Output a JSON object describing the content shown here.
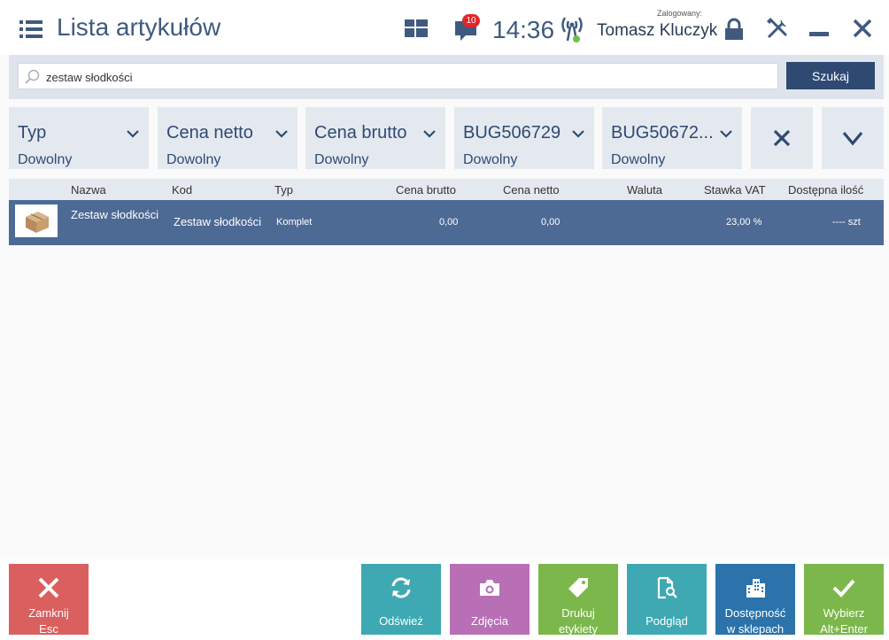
{
  "header": {
    "title": "Lista artykułów",
    "notification_count": "10",
    "time": "14:36",
    "logged_label": "Zalogowany:",
    "user_name": "Tomasz Kluczyk"
  },
  "search": {
    "value": "zestaw słodkości",
    "button_label": "Szukaj"
  },
  "filters": [
    {
      "label": "Typ",
      "value": "Dowolny"
    },
    {
      "label": "Cena netto",
      "value": "Dowolny"
    },
    {
      "label": "Cena brutto",
      "value": "Dowolny"
    },
    {
      "label": "BUG506729",
      "value": "Dowolny"
    },
    {
      "label": "BUG50672...",
      "value": "Dowolny"
    }
  ],
  "table": {
    "columns": [
      "Nazwa",
      "Kod",
      "Typ",
      "Cena brutto",
      "Cena netto",
      "Waluta",
      "Stawka VAT",
      "Dostępna ilość"
    ],
    "rows": [
      {
        "nazwa": "Zestaw słodkości",
        "kod": "Zestaw słodkości",
        "typ": "Komplet",
        "cena_brutto": "0,00",
        "cena_netto": "0,00",
        "waluta": "",
        "stawka_vat": "23,00 %",
        "dostepna_ilosc": "---- szt"
      }
    ]
  },
  "actions": {
    "close": {
      "line1": "Zamknij",
      "line2": "Esc",
      "color": "#d9534f"
    },
    "refresh": {
      "line1": "Odśwież",
      "color": "#3fa9b0"
    },
    "photos": {
      "line1": "Zdjęcia",
      "color": "#b66fb3"
    },
    "print_labels": {
      "line1": "Drukuj",
      "line2": "etykiety",
      "color": "#7ab648"
    },
    "preview": {
      "line1": "Podgląd",
      "color": "#3fa9b0"
    },
    "availability": {
      "line1": "Dostępność",
      "line2": "w sklepach",
      "color": "#2a70a8"
    },
    "select": {
      "line1": "Wybierz",
      "line2": "Alt+Enter",
      "color": "#7ab648"
    }
  },
  "colors": {
    "header_text": "#3f5a7e",
    "selected_row": "#4d6a94",
    "search_button": "#2f4a72"
  }
}
